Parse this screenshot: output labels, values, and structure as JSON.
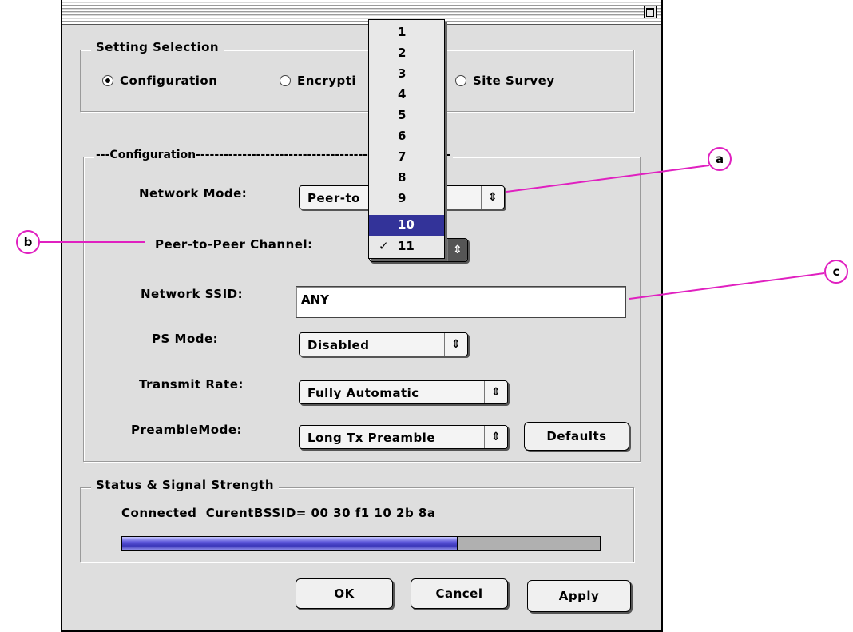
{
  "setting_selection": {
    "title": "Setting Selection",
    "options": [
      "Configuration",
      "Encrypti",
      "Site Survey"
    ],
    "selected": "Configuration"
  },
  "configuration": {
    "title": "---Configuration-------------------------------------------------------",
    "network_mode": {
      "label": "Network Mode:",
      "value": "Peer-to"
    },
    "channel": {
      "label": "Peer-to-Peer Channel:",
      "value": "11"
    },
    "ssid": {
      "label": "Network SSID:",
      "value": "ANY"
    },
    "ps_mode": {
      "label": "PS Mode:",
      "value": "Disabled"
    },
    "transmit_rate": {
      "label": "Transmit Rate:",
      "value": "Fully Automatic"
    },
    "preamble": {
      "label": "PreambleMode:",
      "value": "Long Tx Preamble"
    },
    "defaults_button": "Defaults"
  },
  "channel_menu": {
    "items": [
      "1",
      "2",
      "3",
      "4",
      "5",
      "6",
      "7",
      "8",
      "9",
      "10",
      "11"
    ],
    "highlighted": "10",
    "checked": "11",
    "checkmark": "✓"
  },
  "status": {
    "title": "Status & Signal Strength",
    "text": "Connected  CurentBSSID= 00 30 f1 10 2b 8a",
    "signal_fraction": 0.7
  },
  "buttons": {
    "ok": "OK",
    "cancel": "Cancel",
    "apply": "Apply"
  },
  "callouts": {
    "a": "a",
    "b": "b",
    "c": "c"
  },
  "colors": {
    "callout": "#e020c0",
    "highlight": "#333399",
    "signal": "#3a36b8"
  }
}
